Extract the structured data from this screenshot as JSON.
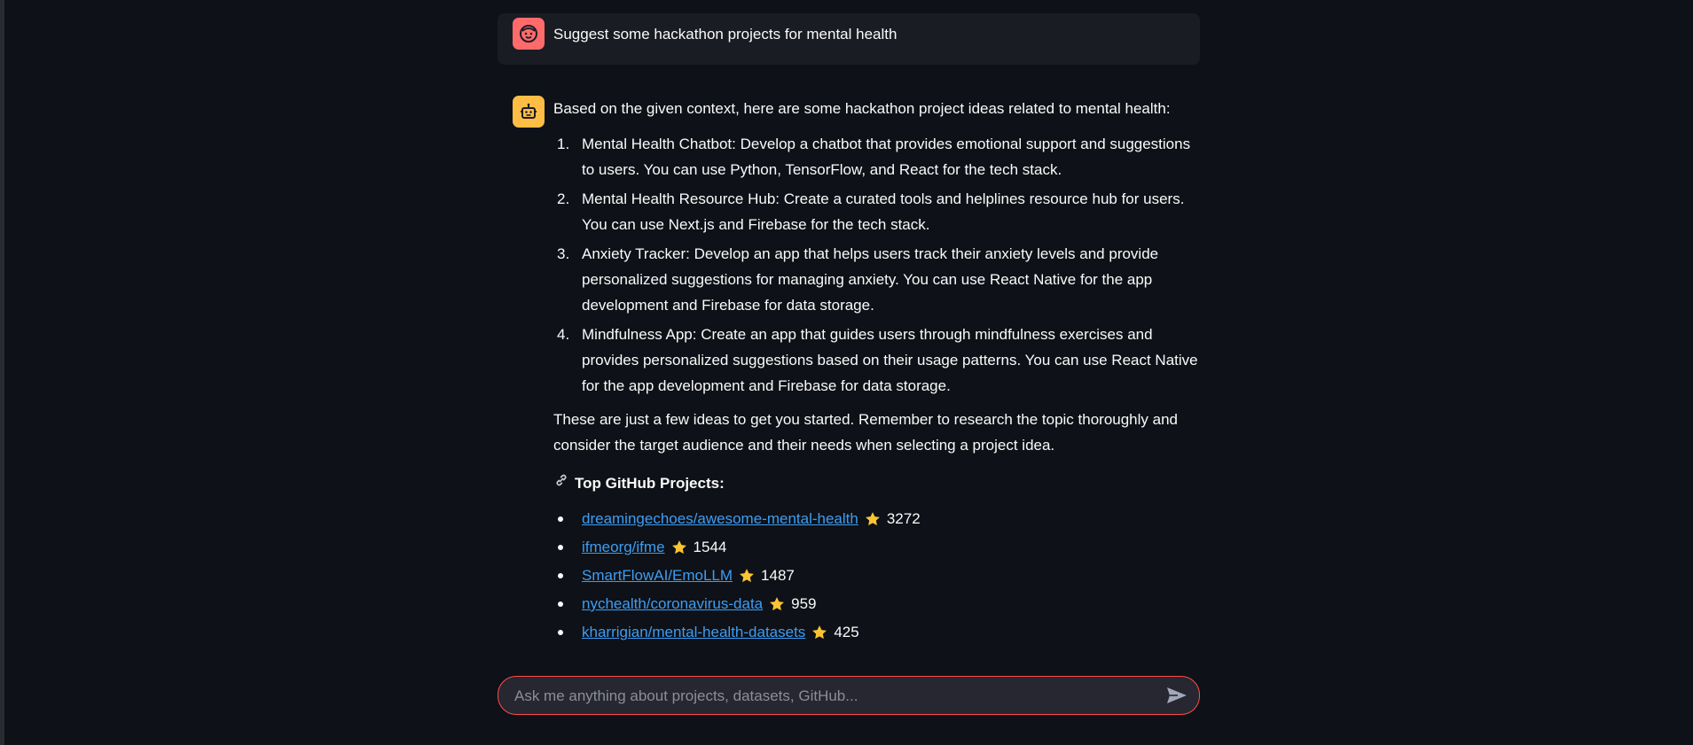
{
  "user_message": {
    "text": "Suggest some hackathon projects for mental health"
  },
  "assistant_message": {
    "intro": "Based on the given context, here are some hackathon project ideas related to mental health:",
    "ideas": [
      {
        "num": "1.",
        "text": "Mental Health Chatbot: Develop a chatbot that provides emotional support and suggestions to users. You can use Python, TensorFlow, and React for the tech stack."
      },
      {
        "num": "2.",
        "text": "Mental Health Resource Hub: Create a curated tools and helplines resource hub for users. You can use Next.js and Firebase for the tech stack."
      },
      {
        "num": "3.",
        "text": "Anxiety Tracker: Develop an app that helps users track their anxiety levels and provide personalized suggestions for managing anxiety. You can use React Native for the app development and Firebase for data storage."
      },
      {
        "num": "4.",
        "text": "Mindfulness App: Create an app that guides users through mindfulness exercises and provides personalized suggestions based on their usage patterns. You can use React Native for the app development and Firebase for data storage."
      }
    ],
    "outro": "These are just a few ideas to get you started. Remember to research the topic thoroughly and consider the target audience and their needs when selecting a project idea.",
    "github_heading": "Top GitHub Projects:",
    "repos": [
      {
        "name": "dreamingechoes/awesome-mental-health",
        "stars": "3272"
      },
      {
        "name": "ifmeorg/ifme",
        "stars": "1544"
      },
      {
        "name": "SmartFlowAI/EmoLLM",
        "stars": "1487"
      },
      {
        "name": "nychealth/coronavirus-data",
        "stars": "959"
      },
      {
        "name": "kharrigian/mental-health-datasets",
        "stars": "425"
      }
    ]
  },
  "chat_input": {
    "placeholder": "Ask me anything about projects, datasets, GitHub..."
  },
  "icons": {
    "user_avatar": "face-icon",
    "assistant_avatar": "robot-icon",
    "link": "link-icon",
    "star": "star-icon",
    "send": "send-icon"
  },
  "colors": {
    "background": "#0e1117",
    "user_avatar": "#ff6b6b",
    "assistant_avatar": "#ffbd45",
    "link": "#3d9df3",
    "input_border": "#ff4b4b"
  }
}
